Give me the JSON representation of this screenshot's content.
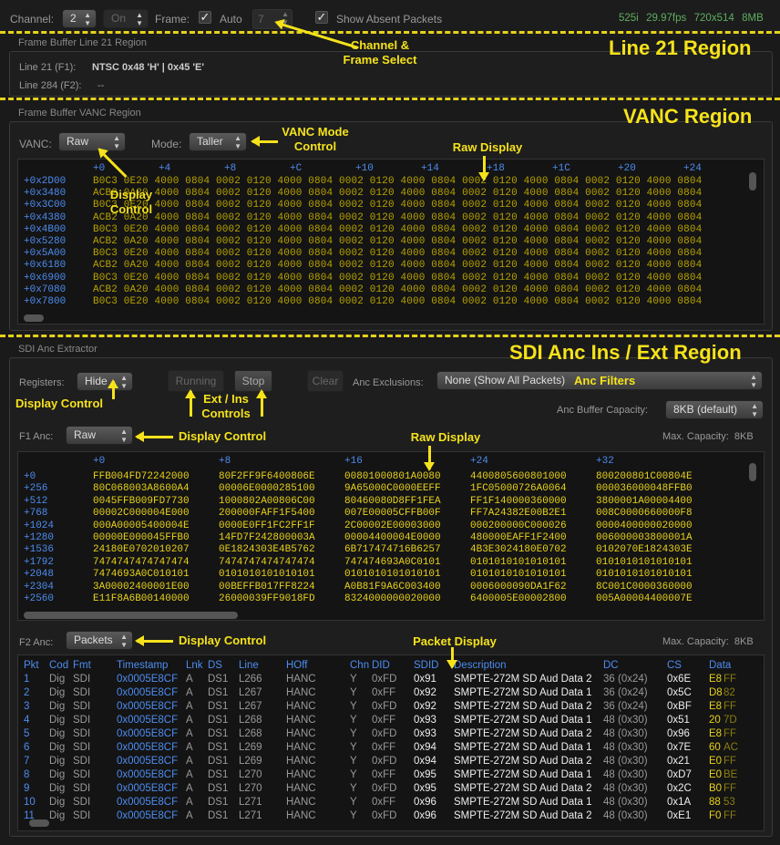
{
  "toolbar": {
    "channel_label": "Channel:",
    "channel_value": "2",
    "on_value": "On",
    "frame_label": "Frame:",
    "auto_label": "Auto",
    "frame_value": "7",
    "absent_label": "Show Absent Packets",
    "status": "525i  29.97fps  720x514  8MB",
    "checkmark": "✓"
  },
  "line21": {
    "section_title": "Frame Buffer Line 21 Region",
    "line1_label": "Line 21 (F1):",
    "line1_value": "NTSC 0x48 'H' | 0x45 'E'",
    "line2_label": "Line 284 (F2):",
    "line2_value": "--"
  },
  "vanc": {
    "section_title": "Frame Buffer VANC Region",
    "vanc_label": "VANC:",
    "vanc_value": "Raw",
    "mode_label": "Mode:",
    "mode_value": "Taller",
    "col_headers": [
      "+0",
      "+4",
      "+8",
      "+C",
      "+10",
      "+14",
      "+18",
      "+1C",
      "+20",
      "+24"
    ],
    "offsets": [
      "+0x2D00",
      "+0x3480",
      "+0x3C00",
      "+0x4380",
      "+0x4B00",
      "+0x5280",
      "+0x5A00",
      "+0x6180",
      "+0x6900",
      "+0x7080",
      "+0x7800"
    ],
    "rows": [
      "B0C3 0E20 4000 0804 0002 0120 4000 0804 0002 0120 4000 0804 0002 0120 4000 0804 0002 0120 4000 0804",
      "ACB2 0A20 4000 0804 0002 0120 4000 0804 0002 0120 4000 0804 0002 0120 4000 0804 0002 0120 4000 0804",
      "B0C3 0E20 4000 0804 0002 0120 4000 0804 0002 0120 4000 0804 0002 0120 4000 0804 0002 0120 4000 0804",
      "ACB2 0A20 4000 0804 0002 0120 4000 0804 0002 0120 4000 0804 0002 0120 4000 0804 0002 0120 4000 0804",
      "B0C3 0E20 4000 0804 0002 0120 4000 0804 0002 0120 4000 0804 0002 0120 4000 0804 0002 0120 4000 0804",
      "ACB2 0A20 4000 0804 0002 0120 4000 0804 0002 0120 4000 0804 0002 0120 4000 0804 0002 0120 4000 0804",
      "B0C3 0E20 4000 0804 0002 0120 4000 0804 0002 0120 4000 0804 0002 0120 4000 0804 0002 0120 4000 0804",
      "ACB2 0A20 4000 0804 0002 0120 4000 0804 0002 0120 4000 0804 0002 0120 4000 0804 0002 0120 4000 0804",
      "B0C3 0E20 4000 0804 0002 0120 4000 0804 0002 0120 4000 0804 0002 0120 4000 0804 0002 0120 4000 0804",
      "ACB2 0A20 4000 0804 0002 0120 4000 0804 0002 0120 4000 0804 0002 0120 4000 0804 0002 0120 4000 0804",
      "B0C3 0E20 4000 0804 0002 0120 4000 0804 0002 0120 4000 0804 0002 0120 4000 0804 0002 0120 4000 0804"
    ]
  },
  "sdi": {
    "section_title": "SDI Anc Extractor",
    "registers_label": "Registers:",
    "registers_value": "Hide",
    "running_label": "Running",
    "stop_label": "Stop",
    "clear_label": "Clear",
    "exclusions_label": "Anc Exclusions:",
    "exclusions_value": "None (Show All Packets)",
    "capacity_label": "Anc Buffer Capacity:",
    "capacity_value": "8KB (default)",
    "f1_label": "F1 Anc:",
    "f1_value": "Raw",
    "f1_maxcap": "Max. Capacity:  8KB",
    "f1_headers": [
      "+0",
      "+8",
      "+16",
      "+24",
      "+32"
    ],
    "f1_offsets": [
      "+0",
      "+256",
      "+512",
      "+768",
      "+1024",
      "+1280",
      "+1536",
      "+1792",
      "+2048",
      "+2304",
      "+2560"
    ],
    "f1_rows": [
      [
        "FFB004FD72242000",
        "80F2FF9F6400806E",
        "00801000801A0080",
        "4400805600801000",
        "800200801C00804E"
      ],
      [
        "80C068003A8600A4",
        "00006E0000285100",
        "9A65000C0000EEFF",
        "1FC05000726A0064",
        "000036000048FFB0"
      ],
      [
        "0045FFB009FD7730",
        "1000802A00806C00",
        "80460080D8FF1FEA",
        "FF1F140000360000",
        "3800001A00004400"
      ],
      [
        "00002C000004E000",
        "200000FAFF1F5400",
        "007E00005CFFB00F",
        "FF7A24382E00B2E1",
        "008C0000660000F8"
      ],
      [
        "000A00005400004E",
        "0000E0FF1FC2FF1F",
        "2C00002E00003000",
        "000200000C000026",
        "0000400000020000"
      ],
      [
        "00000E000045FFB0",
        "14FD7F242800003A",
        "00004400004E0000",
        "480000EAFF1F2400",
        "006000003800001A"
      ],
      [
        "24180E0702010207",
        "0E1824303E4B5762",
        "6B717474716B6257",
        "4B3E3024180E0702",
        "0102070E1824303E"
      ],
      [
        "7474747474747474",
        "7474747474747474",
        "747474693A0C0101",
        "0101010101010101",
        "0101010101010101"
      ],
      [
        "7474693A0C010101",
        "0101010101010101",
        "0101010101010101",
        "0101010101010101",
        "0101010101010101"
      ],
      [
        "3A00002400001E00",
        "00BEFFB017FF8224",
        "A0B81F9A6C003400",
        "0006000090DA1F62",
        "8C001C0000360000"
      ],
      [
        "E11F8A6B00140000",
        "26000039FF9018FD",
        "8324000000020000",
        "6400005E00002800",
        "005A00004400007E"
      ]
    ],
    "f2_label": "F2 Anc:",
    "f2_value": "Packets",
    "f2_maxcap": "Max. Capacity:  8KB",
    "pkt_headers": {
      "pkt": "Pkt",
      "cod": "Cod",
      "fmt": "Fmt",
      "ts": "Timestamp",
      "lnk": "Lnk",
      "ds": "DS",
      "line": "Line",
      "hoff": "HOff",
      "chn": "Chn",
      "did": "DID",
      "sdid": "SDID",
      "desc": "Description",
      "dc": "DC",
      "cs": "CS",
      "data": "Data"
    },
    "packets": [
      [
        "1",
        "Dig",
        "SDI",
        "0x0005E8CF",
        "A",
        "DS1",
        "L266",
        "HANC",
        "Y",
        "0xFD",
        "0x91",
        "SMPTE-272M SD Aud Data 2",
        "36 (0x24)",
        "0x6E",
        "E8",
        "FF"
      ],
      [
        "2",
        "Dig",
        "SDI",
        "0x0005E8CF",
        "A",
        "DS1",
        "L267",
        "HANC",
        "Y",
        "0xFF",
        "0x92",
        "SMPTE-272M SD Aud Data 1",
        "36 (0x24)",
        "0x5C",
        "D8",
        "82"
      ],
      [
        "3",
        "Dig",
        "SDI",
        "0x0005E8CF",
        "A",
        "DS1",
        "L267",
        "HANC",
        "Y",
        "0xFD",
        "0x92",
        "SMPTE-272M SD Aud Data 2",
        "36 (0x24)",
        "0xBF",
        "E8",
        "FF"
      ],
      [
        "4",
        "Dig",
        "SDI",
        "0x0005E8CF",
        "A",
        "DS1",
        "L268",
        "HANC",
        "Y",
        "0xFF",
        "0x93",
        "SMPTE-272M SD Aud Data 1",
        "48 (0x30)",
        "0x51",
        "20",
        "7D"
      ],
      [
        "5",
        "Dig",
        "SDI",
        "0x0005E8CF",
        "A",
        "DS1",
        "L268",
        "HANC",
        "Y",
        "0xFD",
        "0x93",
        "SMPTE-272M SD Aud Data 2",
        "48 (0x30)",
        "0x96",
        "E8",
        "FF"
      ],
      [
        "6",
        "Dig",
        "SDI",
        "0x0005E8CF",
        "A",
        "DS1",
        "L269",
        "HANC",
        "Y",
        "0xFF",
        "0x94",
        "SMPTE-272M SD Aud Data 1",
        "48 (0x30)",
        "0x7E",
        "60",
        "AC"
      ],
      [
        "7",
        "Dig",
        "SDI",
        "0x0005E8CF",
        "A",
        "DS1",
        "L269",
        "HANC",
        "Y",
        "0xFD",
        "0x94",
        "SMPTE-272M SD Aud Data 2",
        "48 (0x30)",
        "0x21",
        "E0",
        "FF"
      ],
      [
        "8",
        "Dig",
        "SDI",
        "0x0005E8CF",
        "A",
        "DS1",
        "L270",
        "HANC",
        "Y",
        "0xFF",
        "0x95",
        "SMPTE-272M SD Aud Data 1",
        "48 (0x30)",
        "0xD7",
        "E0",
        "BE"
      ],
      [
        "9",
        "Dig",
        "SDI",
        "0x0005E8CF",
        "A",
        "DS1",
        "L270",
        "HANC",
        "Y",
        "0xFD",
        "0x95",
        "SMPTE-272M SD Aud Data 2",
        "48 (0x30)",
        "0x2C",
        "B0",
        "FF"
      ],
      [
        "10",
        "Dig",
        "SDI",
        "0x0005E8CF",
        "A",
        "DS1",
        "L271",
        "HANC",
        "Y",
        "0xFF",
        "0x96",
        "SMPTE-272M SD Aud Data 1",
        "48 (0x30)",
        "0x1A",
        "88",
        "53"
      ],
      [
        "11",
        "Dig",
        "SDI",
        "0x0005E8CF",
        "A",
        "DS1",
        "L271",
        "HANC",
        "Y",
        "0xFD",
        "0x96",
        "SMPTE-272M SD Aud Data 2",
        "48 (0x30)",
        "0xE1",
        "F0",
        "FF"
      ]
    ]
  },
  "annotations": {
    "line21_region": "Line 21 Region",
    "vanc_region": "VANC Region",
    "sdi_region": "SDI Anc Ins / Ext Region",
    "channel_frame": "Channel &\nFrame Select",
    "vanc_mode": "VANC Mode\nControl",
    "raw_display": "Raw Display",
    "display_control_vanc": "Display\nControl",
    "display_control_reg": "Display Control",
    "ext_ins": "Ext / Ins\nControls",
    "anc_filters": "Anc Filters",
    "display_control_f1": "Display Control",
    "raw_display_f1": "Raw Display",
    "display_control_f2": "Display Control",
    "packet_display": "Packet Display"
  },
  "colors": {
    "accent": "#f5e21b",
    "offset_blue": "#4d8cf0",
    "hex_yellow": "#b8a300",
    "status_green": "#5fae5f",
    "bg": "#1a1a1a"
  }
}
